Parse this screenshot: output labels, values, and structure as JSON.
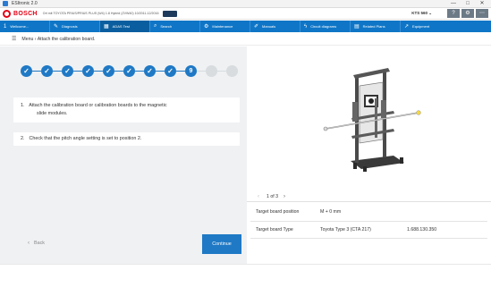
{
  "window": {
    "title": "ESItronic 2.0",
    "buttons": [
      "—",
      "□",
      "✕"
    ]
  },
  "header": {
    "brand": "BOSCH",
    "vehicle_info": "Ort mit TOYOTA PRIUS/PRIUS PLUS (W4) 1.8 Hybrid (ZVW40) 10/2011-12/2016",
    "device_name": "KTS 560 ⌄",
    "icons": [
      "?",
      "⚙",
      "⋯"
    ]
  },
  "navbar": {
    "tabs": [
      {
        "icon": "1",
        "label": "Wellcome..."
      },
      {
        "icon": "✎",
        "label": "Diagnosis"
      },
      {
        "icon": "▦",
        "label": "ADAS Test"
      },
      {
        "icon": "⌕",
        "label": "Search"
      },
      {
        "icon": "⚙",
        "label": "Maintenance"
      },
      {
        "icon": "✐",
        "label": "Manuals"
      },
      {
        "icon": "ϟ",
        "label": "Circuit diagrams"
      },
      {
        "icon": "▤",
        "label": "Related Plans"
      },
      {
        "icon": "↗",
        "label": "Equipment"
      }
    ]
  },
  "breadcrumb": {
    "menu_icon": "☰",
    "text": "Menu › Attach the calibration board."
  },
  "stepper": {
    "current_step": "9",
    "done_mark": "✓"
  },
  "instructions": [
    {
      "number": "1.",
      "line1": "Attach the calibration board or calibration boards to the magnetic",
      "line2": "slide modules."
    },
    {
      "number": "2.",
      "line1": "Check that the pitch angle setting is set to position 2.",
      "line2": ""
    }
  ],
  "actions": {
    "back_label": "Back",
    "back_icon": "‹",
    "continue_label": "Continue"
  },
  "pager": {
    "prev_icon": "‹",
    "count_text": "1 of 3",
    "next_icon": "›"
  },
  "target_table": {
    "rows": [
      {
        "label": "Target board position",
        "value": "M + 0 mm",
        "extra": ""
      },
      {
        "label": "Target board Type",
        "value": "Toyota Type 3 (CTA 217)",
        "extra": "1.688.130.350"
      }
    ]
  },
  "colors": {
    "accent": "#1f79c5",
    "nav": "#0f76c7",
    "brand_red": "#e20015",
    "panel_bg": "#eff1f3"
  }
}
